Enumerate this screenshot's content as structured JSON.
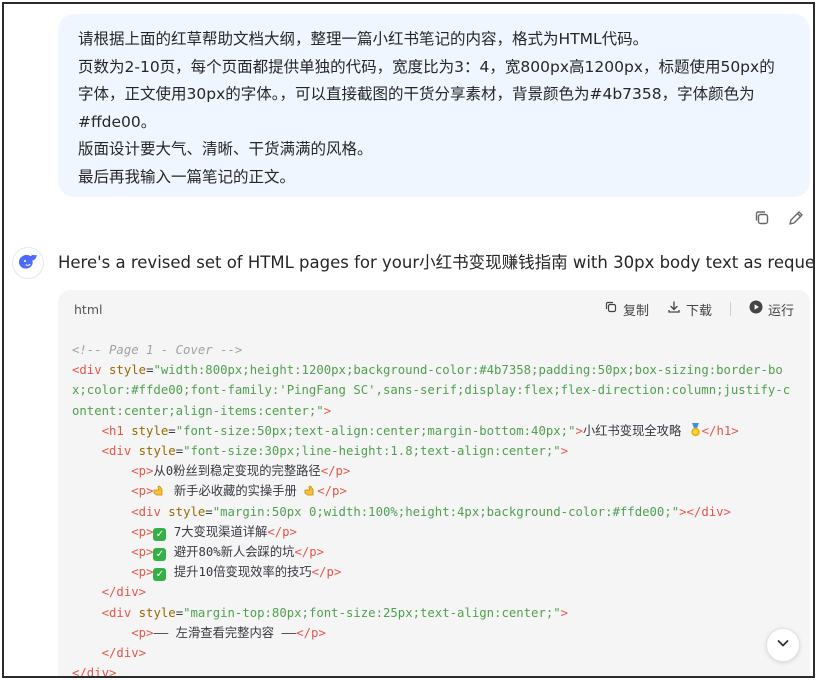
{
  "user_message": {
    "lines": [
      "请根据上面的红草帮助文档大纲，整理一篇小红书笔记的内容，格式为HTML代码。",
      "页数为2-10页，每个页面都提供单独的代码，宽度比为3：4，宽800px高1200px，标题使用50px的",
      "字体，正文使用30px的字体。，可以直接截图的干货分享素材，背景颜色为#4b7358，字体颜色为",
      "#ffde00。",
      "版面设计要大气、清晰、干货满满的风格。",
      "最后再我输入一篇笔记的正文。"
    ]
  },
  "message_actions": {
    "copy_icon": "copy-icon",
    "edit_icon": "edit-pencil-icon"
  },
  "assistant": {
    "avatar_icon": "whale-logo-icon",
    "reply_text": "Here's a revised set of HTML pages for your小红书变现赚钱指南 with 30px body text as requested:"
  },
  "code_block": {
    "language": "html",
    "copy_label": "复制",
    "download_label": "下载",
    "run_label": "运行",
    "lines": {
      "l1": "<!-- Page 1 - Cover -->",
      "l2_attr": "style",
      "l2_val": "\"width:800px;height:1200px;background-color:#4b7358;padding:50px;box-sizing:border-box;color:#ffde00;font-family:'PingFang SC',sans-serif;display:flex;flex-direction:column;justify-content:center;align-items:center;\"",
      "l3_val": "\"font-size:50px;text-align:center;margin-bottom:40px;\"",
      "l3_text": "小红书变现全攻略 ",
      "l4_val": "\"font-size:30px;line-height:1.8;text-align:center;\"",
      "l5_text": "从0粉丝到稳定变现的完整路径",
      "l6_text": " 新手必收藏的实操手册 ",
      "l7_val": "\"margin:50px 0;width:100%;height:4px;background-color:#ffde00;\"",
      "l8_text": " 7大变现渠道详解",
      "l9_text": " 避开80%新人会踩的坑",
      "l10_text": " 提升10倍变现效率的技巧",
      "l12_val": "\"margin-top:80px;font-size:25px;text-align:center;\"",
      "l13_text": "—— 左滑查看完整内容 ——"
    }
  },
  "scroll_button_icon": "chevron-down-icon",
  "colors": {
    "bubble_bg": "#eff6ff",
    "code_bg": "#f5f5f5",
    "tag": "#e45649",
    "attr": "#986801",
    "string": "#50a14f"
  }
}
